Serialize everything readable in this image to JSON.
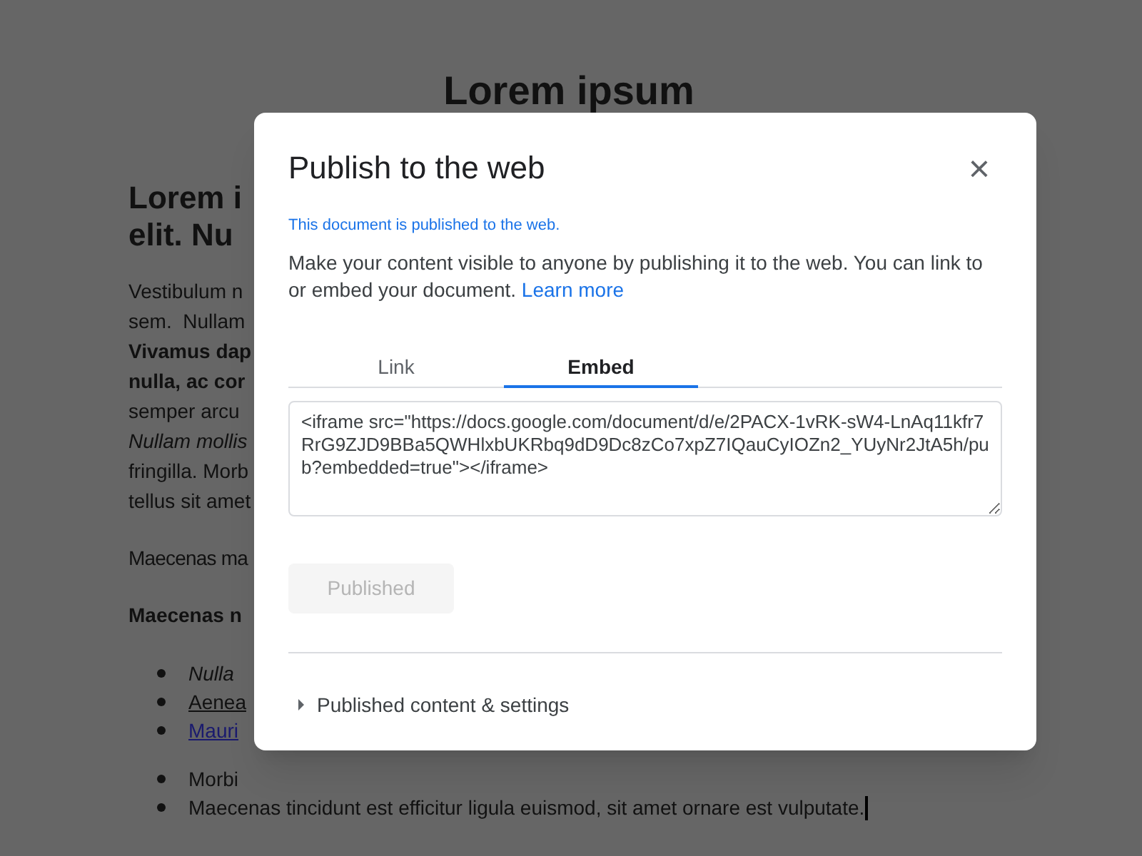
{
  "document": {
    "title": "Lorem ipsum",
    "heading_lines": [
      "Lorem i",
      "elit. Nu"
    ],
    "paragraph_lines": [
      {
        "text": "Vestibulum n",
        "kind": "plain"
      },
      {
        "text": "sem.  Nullam",
        "kind": "plain"
      },
      {
        "text": "Vivamus dap",
        "kind": "bold"
      },
      {
        "text": "nulla, ac cor",
        "kind": "bold"
      },
      {
        "text": "semper arcu",
        "kind": "plain"
      },
      {
        "text": "Nullam mollis",
        "kind": "italic"
      },
      {
        "text": "fringilla. Morb",
        "kind": "plain"
      },
      {
        "text": "tellus sit amet",
        "kind": "plain"
      }
    ],
    "paragraph_2": "Maecenas ma",
    "paragraph_3": "Maecenas n",
    "list_1": [
      {
        "text": "Nulla",
        "kind": "italic"
      },
      {
        "text": "Aenea",
        "kind": "underline"
      },
      {
        "text": "Mauri",
        "kind": "link"
      }
    ],
    "list_2": [
      "Morbi",
      "Maecenas tincidunt est efficitur ligula euismod, sit amet ornare est vulputate."
    ]
  },
  "dialog": {
    "title": "Publish to the web",
    "close": "×",
    "status": "This document is published to the web.",
    "description": "Make your content visible to anyone by publishing it to the web. You can link to or embed your document.",
    "learn_more": "Learn more",
    "tabs": [
      {
        "label": "Link",
        "selected": false
      },
      {
        "label": "Embed",
        "selected": true
      }
    ],
    "embed_code": "<iframe src=\"https://docs.google.com/document/d/e/2PACX-1vRK-sW4-LnAq11kfr7RrG9ZJD9BBa5QWHlxbUKRbq9dD9Dc8zCo7xpZ7IQauCyIOZn2_YUyNr2JtA5h/pub?embedded=true\"></iframe>",
    "publish_button": {
      "label": "Published",
      "disabled": true
    },
    "settings": {
      "label": "Published content & settings",
      "expanded": false
    }
  }
}
